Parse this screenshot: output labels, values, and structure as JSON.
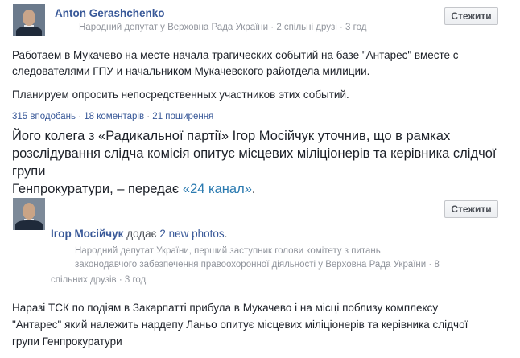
{
  "post1": {
    "author": "Anton Gerashchenko",
    "subtitle": "Народний депутат у Верховна Рада України",
    "mutual": "2 спільні друзі",
    "time": "3 год",
    "follow_label": "Стежити",
    "text_line1": "Работаем в Мукачево на месте начала трагических событий на базе \"Антарес\" вместе с",
    "text_line2": "следователями ГПУ и начальником Мукачевского райотдела милиции.",
    "text_line3": "Планируем опросить непосредственных участников этих событий.",
    "reactions": "315 вподобань",
    "comments": "18 коментарів",
    "shares": "21 поширення"
  },
  "article": {
    "line1": "Його колега з «Радикальної партії» Ігор Мосійчук уточнив, що в рамках",
    "line2": "розслідування слідча комісія опитує місцевих міліціонерів та керівника слідчої групи",
    "line3_prefix": "Генпрокуратури, – передає ",
    "line3_link": "«24 канал»",
    "line3_suffix": "."
  },
  "post2": {
    "author": "Ігор Мосійчук",
    "action": "додає",
    "photos": "2 new photos",
    "action_end": ".",
    "subtitle_line1": "Народний депутат України, перший заступник голови комітету з питань",
    "subtitle_line2a": "законодавчого забезпечення правоохоронної діяльності у Верховна Рада України",
    "subtitle_line2b": "8",
    "subtitle_line3a": "спільних друзів",
    "time": "3 год",
    "follow_label": "Стежити",
    "text_line1": "Наразі ТСК по подіям в Закарпатті прибула в Мукачево і на місці поблизу комплексу",
    "text_line2": "\"Антарес\" який належить нардепу Ланьо опитує місцевих міліціонерів та керівника слідчої",
    "text_line3": "групи Генпрокуратури"
  }
}
